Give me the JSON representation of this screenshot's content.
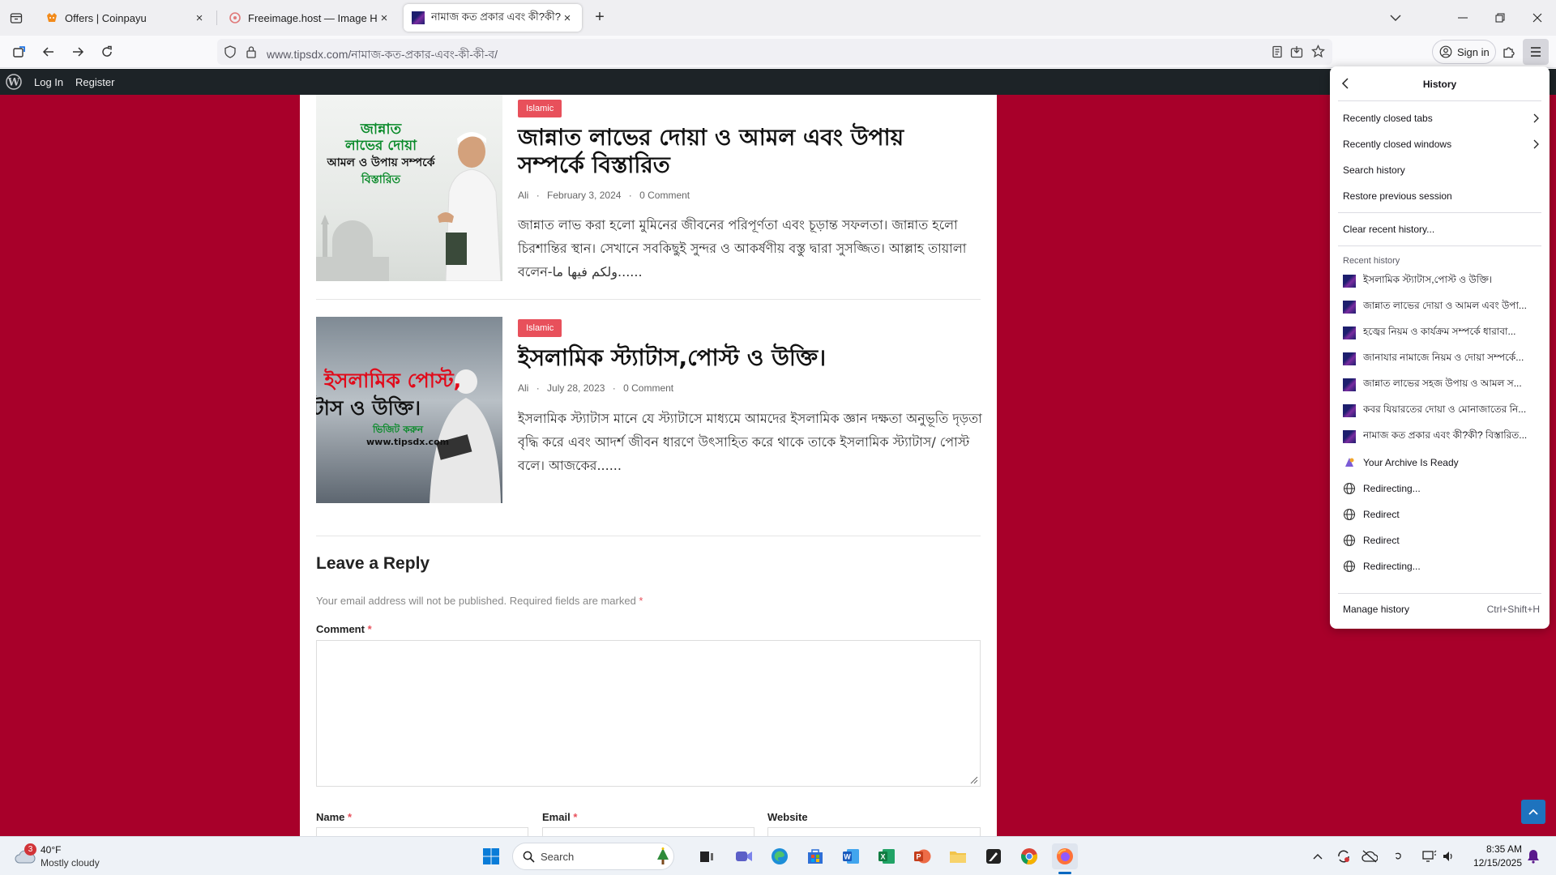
{
  "browser": {
    "tabs": [
      {
        "title": "Offers | Coinpayu",
        "close": "×"
      },
      {
        "title": "Freeimage.host — Image Hosting",
        "close": "×"
      },
      {
        "title": "নামাজ কত প্রকার এবং কী?কী? বিস্তারিত",
        "close": "×"
      }
    ],
    "new_tab": "+",
    "url_domain": "www.tipsdx.com",
    "url_path": "/নামাজ-কত-প্রকার-এবং-কী-কী-ব/",
    "sign_in": "Sign in"
  },
  "wp_bar": {
    "login": "Log In",
    "register": "Register"
  },
  "posts": [
    {
      "category": "Islamic",
      "title": "জান্নাত লাভের দোয়া ও আমল এবং উপায় সম্পর্কে বিস্তারিত",
      "author": "Ali",
      "date": "February 3, 2024",
      "comments": "0 Comment",
      "excerpt": "জান্নাত লাভ করা হলো মুমিনের জীবনের পরিপূর্ণতা এবং চূড়ান্ত সফলতা। জান্নাত হলো চিরশান্তির স্থান। সেখানে সবকিছুই সুন্দর ও আকর্ষণীয় বস্তু দ্বারা সুসজ্জিত। আল্লাহ তায়ালা বলেন-ولكم فيها ما......",
      "thumb_lines": [
        "জান্নাত",
        "লাভের দোয়া",
        "আমল ও উপায় সম্পর্কে",
        "বিস্তারিত"
      ]
    },
    {
      "category": "Islamic",
      "title": "ইসলামিক স্ট্যাটাস,পোস্ট ও উক্তি।",
      "author": "Ali",
      "date": "July 28, 2023",
      "comments": "0 Comment",
      "excerpt": "ইসলামিক স্ট্যাটাস মানে যে স্ট্যাটাসে মাধ্যমে আমদের ইসলামিক জ্ঞান দক্ষতা অনুভূতি দৃড়তা বৃদ্ধি করে এবং আদর্শ জীবন ধারণে উৎসাহিত করে থাকে তাকে ইসলামিক স্ট্যাটাস/ পোস্ট বলে। আজকের......",
      "thumb_lines": [
        "ইসলামিক পোস্ট,",
        "টাস ও উক্তি।",
        "ভিজিট করুন",
        "www.tipsdx.com"
      ]
    }
  ],
  "reply": {
    "heading": "Leave a Reply",
    "note": "Your email address will not be published. Required fields are marked",
    "required_mark": "*",
    "comment_label": "Comment",
    "name_label": "Name",
    "email_label": "Email",
    "website_label": "Website"
  },
  "history_panel": {
    "title": "History",
    "recently_closed_tabs": "Recently closed tabs",
    "recently_closed_windows": "Recently closed windows",
    "search_history": "Search history",
    "restore_session": "Restore previous session",
    "clear_recent": "Clear recent history...",
    "section_label": "Recent history",
    "items": [
      {
        "label": "ইসলামিক স্ট্যাটাস,পোস্ট ও উক্তি।",
        "icon": "site-favicon"
      },
      {
        "label": "জান্নাত লাভের দোয়া ও আমল এবং উপা...",
        "icon": "site-favicon"
      },
      {
        "label": "হজ্বের নিয়ম ও কার্যক্রম সম্পর্কে ধারাবা...",
        "icon": "site-favicon"
      },
      {
        "label": "জানাযার নামাজে নিয়ম ও দোয়া সম্পর্কে...",
        "icon": "site-favicon"
      },
      {
        "label": "জান্নাত লাভের সহজ উপায় ও আমল স...",
        "icon": "site-favicon"
      },
      {
        "label": "কবর যিয়ারতের দোয়া ও মোনাজাতের নি...",
        "icon": "site-favicon"
      },
      {
        "label": "নামাজ কত প্রকার এবং কী?কী? বিস্তারিত...",
        "icon": "site-favicon"
      },
      {
        "label": "Your Archive Is Ready",
        "icon": "archive-favicon"
      },
      {
        "label": "Redirecting...",
        "icon": "globe-icon"
      },
      {
        "label": "Redirect",
        "icon": "globe-icon"
      },
      {
        "label": "Redirect",
        "icon": "globe-icon"
      },
      {
        "label": "Redirecting...",
        "icon": "globe-icon"
      }
    ],
    "manage": "Manage history",
    "manage_shortcut": "Ctrl+Shift+H"
  },
  "taskbar": {
    "weather_temp": "40°F",
    "weather_desc": "Mostly cloudy",
    "weather_badge": "3",
    "search_placeholder": "Search",
    "time": "8:35 AM",
    "date": "12/15/2025"
  },
  "colors": {
    "page_bg": "#a8002a",
    "badge": "#e8505b",
    "wp_bar": "#1d2327",
    "scroll_top_button": "#1e73be"
  }
}
